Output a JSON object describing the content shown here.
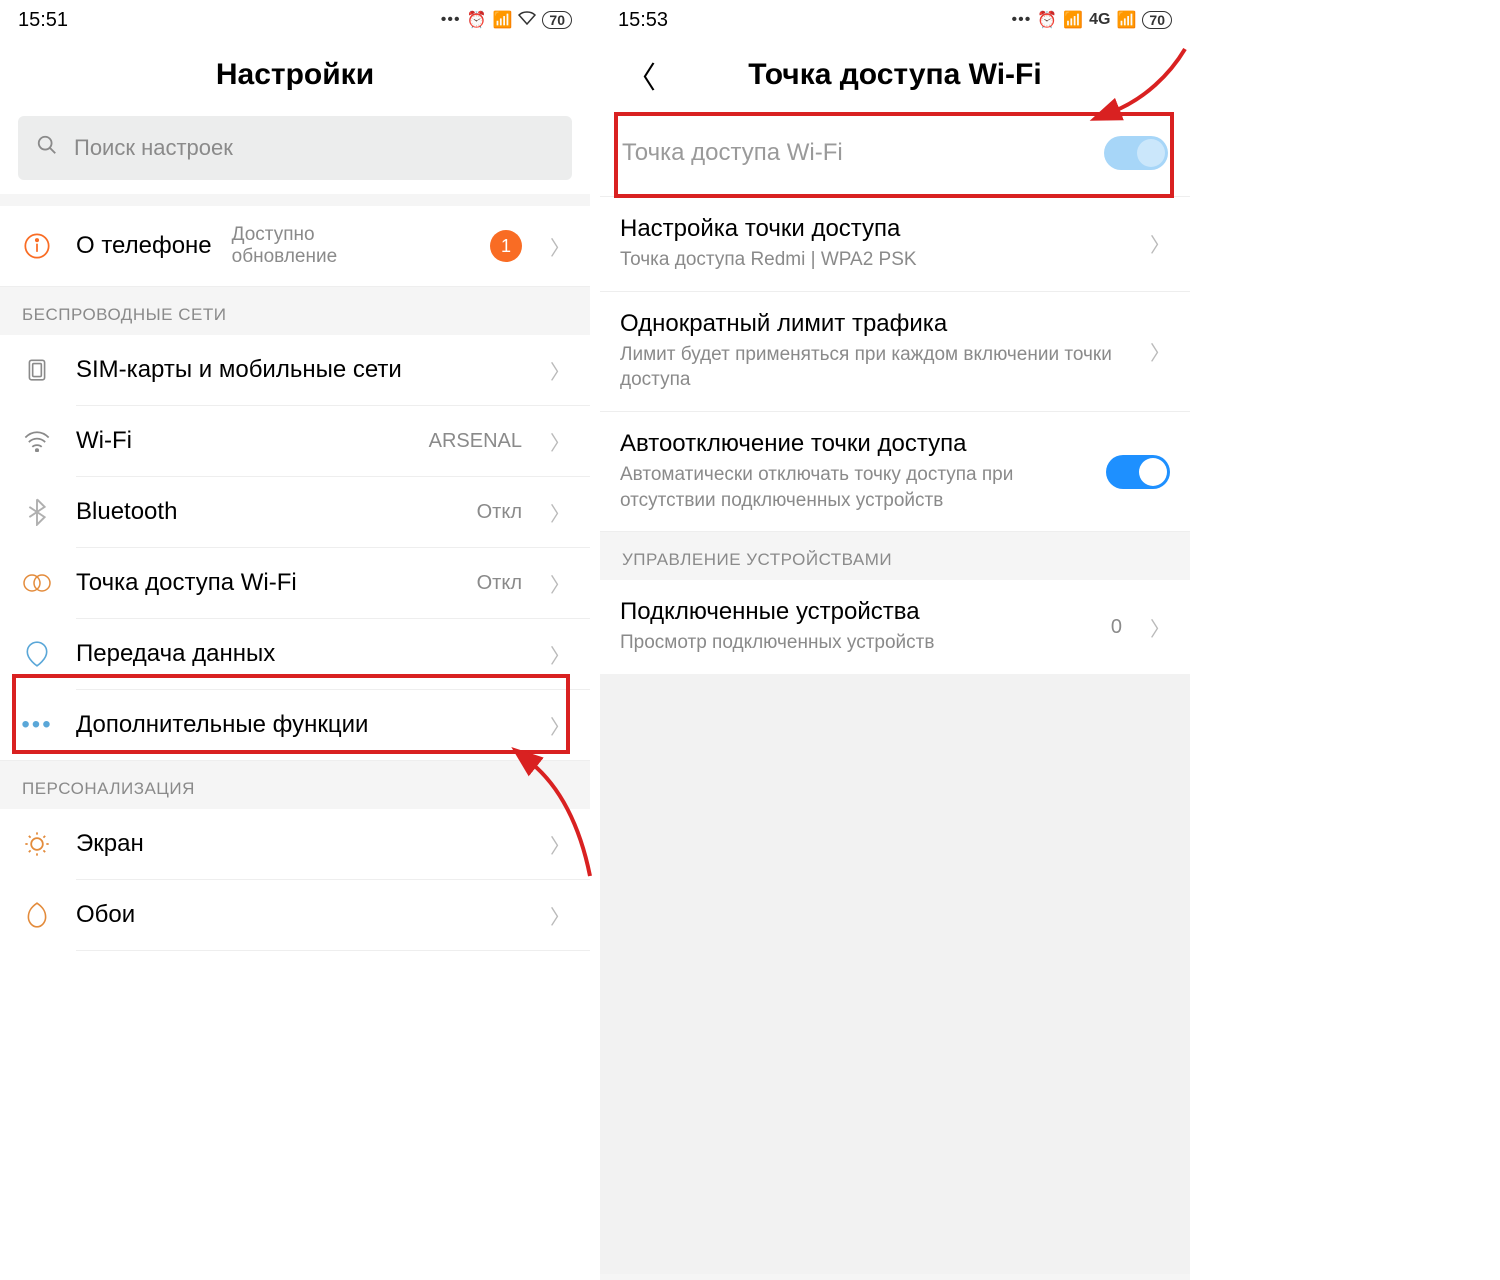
{
  "left": {
    "time": "15:51",
    "battery": "70",
    "title": "Настройки",
    "search_placeholder": "Поиск настроек",
    "about": {
      "label": "О телефоне",
      "sub1": "Доступно",
      "sub2": "обновление",
      "badge": "1"
    },
    "section_wireless": "БЕСПРОВОДНЫЕ СЕТИ",
    "sim": "SIM-карты и мобильные сети",
    "wifi": {
      "label": "Wi-Fi",
      "value": "ARSENAL"
    },
    "bluetooth": {
      "label": "Bluetooth",
      "value": "Откл"
    },
    "hotspot": {
      "label": "Точка доступа Wi-Fi",
      "value": "Откл"
    },
    "data": "Передача данных",
    "more": "Дополнительные функции",
    "section_personal": "ПЕРСОНАЛИЗАЦИЯ",
    "display": "Экран",
    "wallpaper": "Обои"
  },
  "right": {
    "time": "15:53",
    "net": "4G",
    "battery": "70",
    "title": "Точка доступа Wi-Fi",
    "toggle_label": "Точка доступа Wi-Fi",
    "setup": {
      "label": "Настройка точки доступа",
      "sub": "Точка доступа Redmi | WPA2 PSK"
    },
    "limit": {
      "label": "Однократный лимит трафика",
      "sub": "Лимит будет применяться при каждом включении точки доступа"
    },
    "auto_off": {
      "label": "Автоотключение точки доступа",
      "sub": "Автоматически отключать точку доступа при отсутствии подключенных устройств"
    },
    "section_devices": "УПРАВЛЕНИЕ УСТРОЙСТВАМИ",
    "connected": {
      "label": "Подключенные устройства",
      "sub": "Просмотр подключенных устройств",
      "value": "0"
    }
  }
}
